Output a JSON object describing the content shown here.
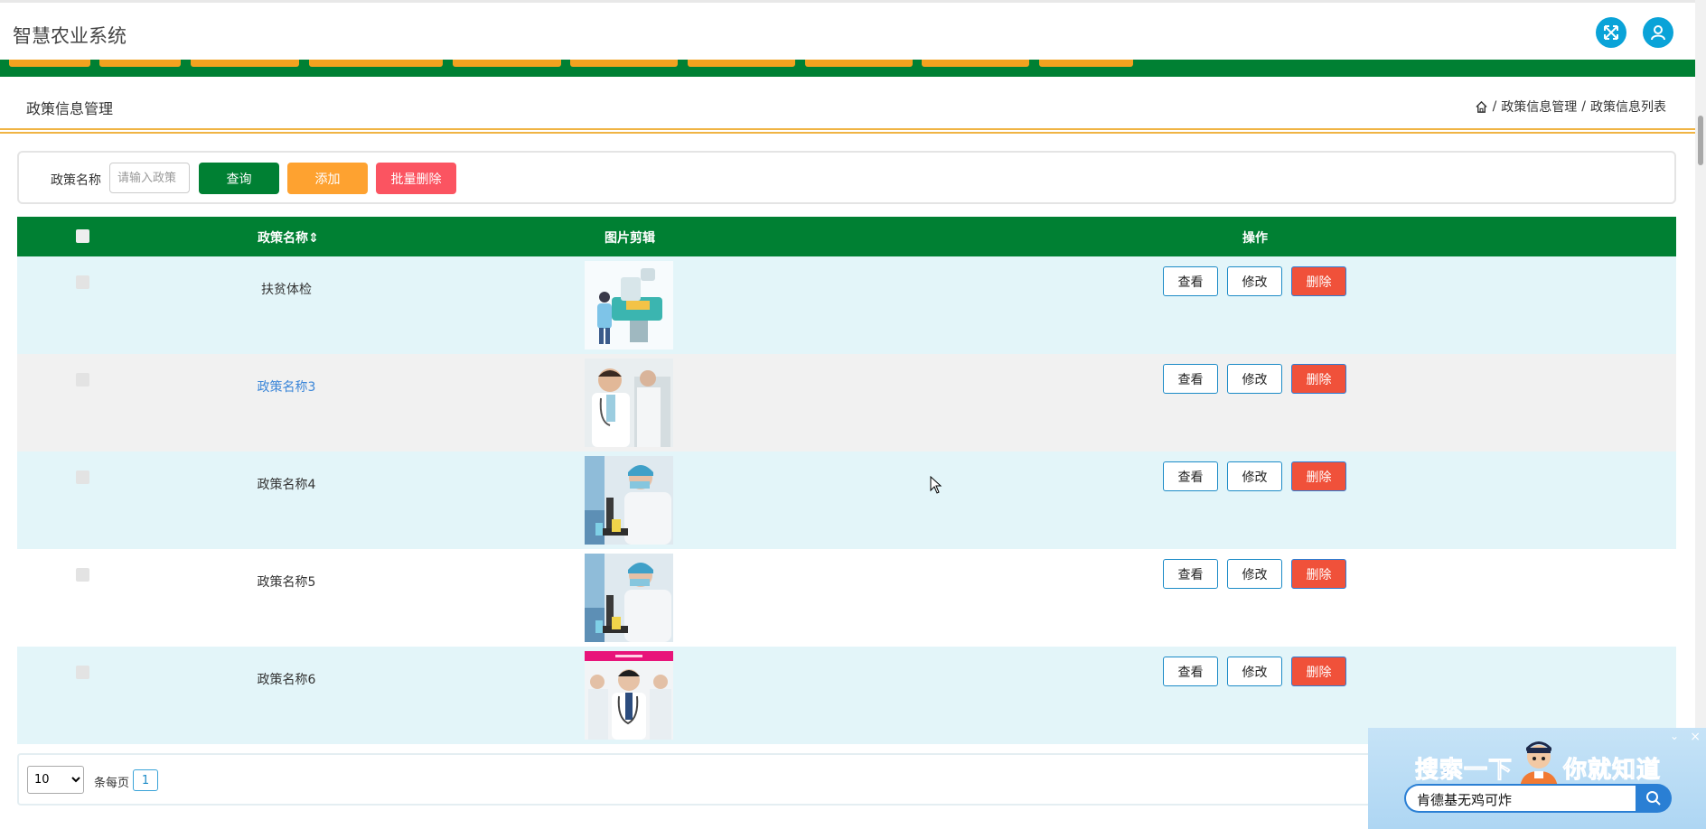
{
  "app": {
    "title": "智慧农业系统"
  },
  "header": {
    "fullscreen_icon": "expand-icon",
    "user_icon": "user-icon"
  },
  "breadcrumb": {
    "title": "政策信息管理",
    "home_icon": "home-icon",
    "separator": "/",
    "items": [
      "政策信息管理",
      "政策信息列表"
    ]
  },
  "search": {
    "label": "政策名称",
    "placeholder": "请输入政策",
    "query_button": "查询",
    "add_button": "添加",
    "batch_delete_button": "批量删除"
  },
  "table": {
    "columns": [
      "政策名称",
      "图片剪辑",
      "操作"
    ],
    "sort_glyph": "⇕",
    "rows": [
      {
        "name": "扶贫体检",
        "highlight": false
      },
      {
        "name": "政策名称3",
        "highlight": true
      },
      {
        "name": "政策名称4",
        "highlight": false
      },
      {
        "name": "政策名称5",
        "highlight": false
      },
      {
        "name": "政策名称6",
        "highlight": false
      }
    ],
    "actions": {
      "view": "查看",
      "edit": "修改",
      "delete": "删除"
    }
  },
  "pagination": {
    "page_size": "10",
    "page_size_options": [
      "10"
    ],
    "per_page_label": "条每页",
    "current_page": "1"
  },
  "ad": {
    "slogan_left": "搜索一下",
    "slogan_right": "你就知道",
    "search_value": "肯德基无鸡可炸",
    "close": "×",
    "collapse": "⌄"
  },
  "colors": {
    "primary_green": "#008033",
    "nav_orange": "#f3a21f",
    "add_orange": "#fea230",
    "delete_red": "#f0513a",
    "row_cyan": "#e3f5f9",
    "row_gray": "#f1f1f1",
    "link_blue": "#3b86d8"
  }
}
